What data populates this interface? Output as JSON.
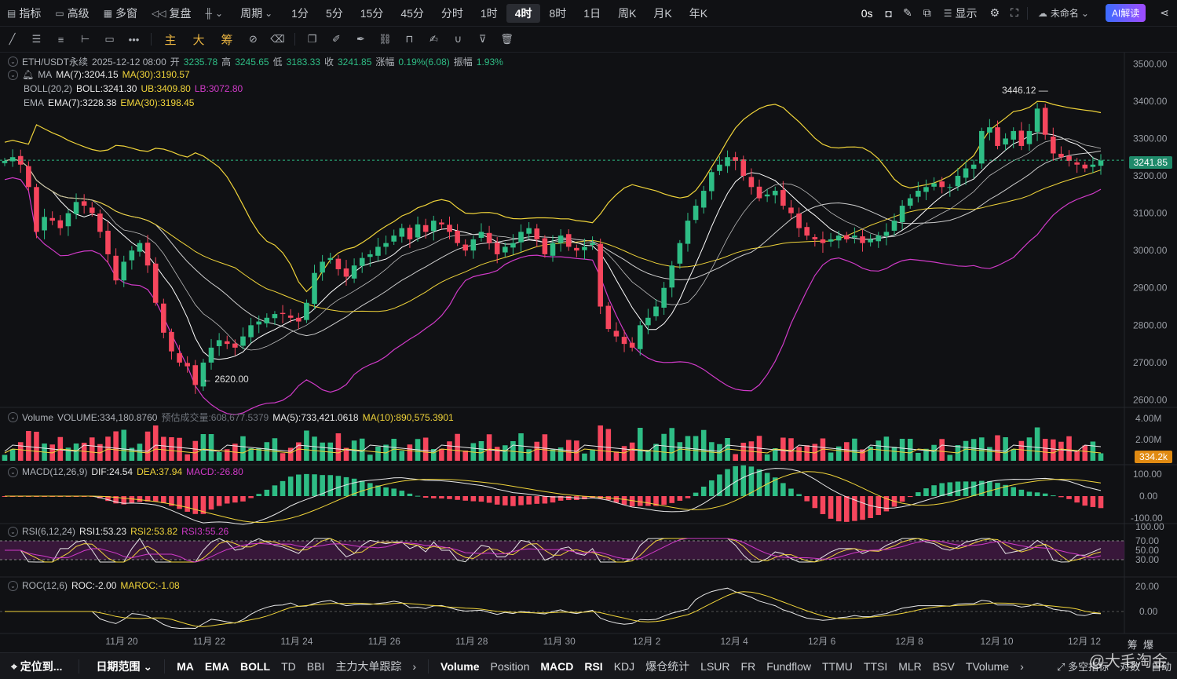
{
  "topbar": {
    "left": [
      {
        "icon": "indicator-icon",
        "label": "指标"
      },
      {
        "icon": "advanced-icon",
        "label": "高级"
      },
      {
        "icon": "multi-window-icon",
        "label": "多窗"
      },
      {
        "icon": "replay-icon",
        "label": "复盘"
      },
      {
        "icon": "chart-type-icon",
        "label": ""
      },
      {
        "icon": "",
        "label": "周期"
      }
    ],
    "periods": [
      "1分",
      "5分",
      "15分",
      "45分",
      "分时",
      "1时",
      "4时",
      "8时",
      "1日",
      "周K",
      "月K",
      "年K"
    ],
    "active_period": "4时",
    "right": {
      "countdown": "0s",
      "display_label": "显示",
      "unnamed_label": "未命名",
      "ai_label": "AI解读"
    }
  },
  "toolbar": {
    "chinese_tools": [
      "主",
      "大",
      "筹"
    ]
  },
  "chart": {
    "info": {
      "symbol": "ETH/USDT永续",
      "time": "2025-12-12 08:00",
      "open_label": "开",
      "open": "3235.78",
      "high_label": "高",
      "high": "3245.65",
      "low_label": "低",
      "low": "3183.33",
      "close_label": "收",
      "close": "3241.85",
      "change_label": "涨幅",
      "change": "0.19%(6.08)",
      "amplitude_label": "振幅",
      "amplitude": "1.93%"
    },
    "ma": {
      "name": "MA",
      "ma7": "MA(7):3204.15",
      "ma30": "MA(30):3190.57"
    },
    "boll": {
      "name": "BOLL(20,2)",
      "mid": "BOLL:3241.30",
      "ub": "UB:3409.80",
      "lb": "LB:3072.80"
    },
    "ema": {
      "name": "EMA",
      "ema7": "EMA(7):3228.38",
      "ema30": "EMA(30):3198.45"
    },
    "price_axis": [
      "3500.00",
      "3400.00",
      "3300.00",
      "3200.00",
      "3100.00",
      "3000.00",
      "2900.00",
      "2800.00",
      "2700.00",
      "2600.00"
    ],
    "current_price": "3241.85",
    "high_marker": "3446.12",
    "low_marker": "← 2620.00",
    "dates": [
      "11月 20",
      "11月 22",
      "11月 24",
      "11月 26",
      "11月 28",
      "11月 30",
      "12月 2",
      "12月 4",
      "12月 6",
      "12月 8",
      "12月 10",
      "12月 12"
    ]
  },
  "volume": {
    "title": "Volume",
    "vol": "VOLUME:334,180.8760",
    "est": "预估成交量:608,677.5379",
    "ma5": "MA(5):733,421.0618",
    "ma10": "MA(10):890,575.3901",
    "axis": [
      "4.00M",
      "2.00M"
    ],
    "current": "334.2k"
  },
  "macd": {
    "name": "MACD(12,26,9)",
    "dif": "DIF:24.54",
    "dea": "DEA:37.94",
    "macd": "MACD:-26.80",
    "axis": [
      "100.00",
      "0.00",
      "-100.00"
    ]
  },
  "rsi": {
    "name": "RSI(6,12,24)",
    "rsi1": "RSI1:53.23",
    "rsi2": "RSI2:53.82",
    "rsi3": "RSI3:55.26",
    "axis": [
      "100.00",
      "70.00",
      "50.00",
      "30.00"
    ]
  },
  "roc": {
    "name": "ROC(12,6)",
    "roc": "ROC:-2.00",
    "maroc": "MAROC:-1.08",
    "axis": [
      "20.00",
      "0.00"
    ]
  },
  "bottombar": {
    "left": [
      "定位到...",
      "日期范围"
    ],
    "main_indicators": [
      "MA",
      "EMA",
      "BOLL",
      "TD",
      "BBI",
      "主力大单跟踪"
    ],
    "sub_indicators": [
      "Volume",
      "Position",
      "MACD",
      "RSI",
      "KDJ",
      "爆仓统计",
      "LSUR",
      "FR",
      "Fundflow",
      "TTMU",
      "TTSI",
      "MLR",
      "BSV",
      "TVolume"
    ],
    "right": [
      "多空指标",
      "对数",
      "自动"
    ]
  },
  "side_labels": [
    "筹",
    "爆"
  ],
  "watermark": "@大毛淘金",
  "colors": {
    "up": "#2ebd85",
    "down": "#f6465d",
    "ma7": "#e8e8e8",
    "ma30": "#f0d43a",
    "boll_lb": "#d03ac8",
    "accent": "#3b6cff"
  },
  "chart_data": {
    "type": "candlestick",
    "title": "ETH/USDT永续 4时",
    "close_series": [
      3240,
      3250,
      3230,
      3170,
      3050,
      3090,
      3080,
      3060,
      3100,
      3130,
      3120,
      3100,
      3050,
      2990,
      2920,
      2970,
      3000,
      3020,
      2960,
      2860,
      2780,
      2730,
      2700,
      2690,
      2640,
      2700,
      2740,
      2760,
      2750,
      2740,
      2770,
      2800,
      2810,
      2820,
      2830,
      2830,
      2820,
      2810,
      2860,
      2940,
      2970,
      2980,
      2950,
      2930,
      2960,
      2980,
      2990,
      3010,
      3020,
      3040,
      3060,
      3030,
      3070,
      3050,
      3080,
      3070,
      3050,
      3020,
      3000,
      3030,
      3050,
      3020,
      2990,
      3010,
      3020,
      3050,
      3060,
      3030,
      2990,
      3020,
      3040,
      3010,
      3000,
      3010,
      3020,
      2850,
      2790,
      2770,
      2750,
      2740,
      2800,
      2820,
      2850,
      2900,
      2960,
      3020,
      3080,
      3120,
      3160,
      3210,
      3230,
      3250,
      3240,
      3200,
      3170,
      3140,
      3150,
      3160,
      3120,
      3100,
      3060,
      3040,
      3030,
      3020,
      3030,
      3040,
      3030,
      3040,
      3020,
      3030,
      3040,
      3050,
      3080,
      3120,
      3140,
      3160,
      3170,
      3180,
      3170,
      3170,
      3200,
      3220,
      3230,
      3320,
      3330,
      3280,
      3300,
      3320,
      3280,
      3320,
      3380,
      3310,
      3260,
      3250,
      3240,
      3230,
      3220,
      3230,
      3241
    ],
    "price_axis_range": [
      2600,
      3500
    ]
  }
}
